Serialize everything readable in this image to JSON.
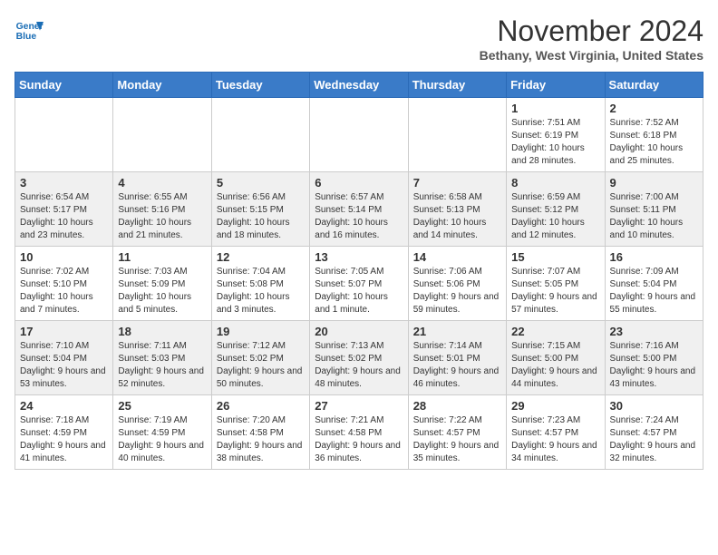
{
  "header": {
    "logo_line1": "General",
    "logo_line2": "Blue",
    "month": "November 2024",
    "location": "Bethany, West Virginia, United States"
  },
  "weekdays": [
    "Sunday",
    "Monday",
    "Tuesday",
    "Wednesday",
    "Thursday",
    "Friday",
    "Saturday"
  ],
  "weeks": [
    [
      {
        "day": "",
        "info": ""
      },
      {
        "day": "",
        "info": ""
      },
      {
        "day": "",
        "info": ""
      },
      {
        "day": "",
        "info": ""
      },
      {
        "day": "",
        "info": ""
      },
      {
        "day": "1",
        "info": "Sunrise: 7:51 AM\nSunset: 6:19 PM\nDaylight: 10 hours and 28 minutes."
      },
      {
        "day": "2",
        "info": "Sunrise: 7:52 AM\nSunset: 6:18 PM\nDaylight: 10 hours and 25 minutes."
      }
    ],
    [
      {
        "day": "3",
        "info": "Sunrise: 6:54 AM\nSunset: 5:17 PM\nDaylight: 10 hours and 23 minutes."
      },
      {
        "day": "4",
        "info": "Sunrise: 6:55 AM\nSunset: 5:16 PM\nDaylight: 10 hours and 21 minutes."
      },
      {
        "day": "5",
        "info": "Sunrise: 6:56 AM\nSunset: 5:15 PM\nDaylight: 10 hours and 18 minutes."
      },
      {
        "day": "6",
        "info": "Sunrise: 6:57 AM\nSunset: 5:14 PM\nDaylight: 10 hours and 16 minutes."
      },
      {
        "day": "7",
        "info": "Sunrise: 6:58 AM\nSunset: 5:13 PM\nDaylight: 10 hours and 14 minutes."
      },
      {
        "day": "8",
        "info": "Sunrise: 6:59 AM\nSunset: 5:12 PM\nDaylight: 10 hours and 12 minutes."
      },
      {
        "day": "9",
        "info": "Sunrise: 7:00 AM\nSunset: 5:11 PM\nDaylight: 10 hours and 10 minutes."
      }
    ],
    [
      {
        "day": "10",
        "info": "Sunrise: 7:02 AM\nSunset: 5:10 PM\nDaylight: 10 hours and 7 minutes."
      },
      {
        "day": "11",
        "info": "Sunrise: 7:03 AM\nSunset: 5:09 PM\nDaylight: 10 hours and 5 minutes."
      },
      {
        "day": "12",
        "info": "Sunrise: 7:04 AM\nSunset: 5:08 PM\nDaylight: 10 hours and 3 minutes."
      },
      {
        "day": "13",
        "info": "Sunrise: 7:05 AM\nSunset: 5:07 PM\nDaylight: 10 hours and 1 minute."
      },
      {
        "day": "14",
        "info": "Sunrise: 7:06 AM\nSunset: 5:06 PM\nDaylight: 9 hours and 59 minutes."
      },
      {
        "day": "15",
        "info": "Sunrise: 7:07 AM\nSunset: 5:05 PM\nDaylight: 9 hours and 57 minutes."
      },
      {
        "day": "16",
        "info": "Sunrise: 7:09 AM\nSunset: 5:04 PM\nDaylight: 9 hours and 55 minutes."
      }
    ],
    [
      {
        "day": "17",
        "info": "Sunrise: 7:10 AM\nSunset: 5:04 PM\nDaylight: 9 hours and 53 minutes."
      },
      {
        "day": "18",
        "info": "Sunrise: 7:11 AM\nSunset: 5:03 PM\nDaylight: 9 hours and 52 minutes."
      },
      {
        "day": "19",
        "info": "Sunrise: 7:12 AM\nSunset: 5:02 PM\nDaylight: 9 hours and 50 minutes."
      },
      {
        "day": "20",
        "info": "Sunrise: 7:13 AM\nSunset: 5:02 PM\nDaylight: 9 hours and 48 minutes."
      },
      {
        "day": "21",
        "info": "Sunrise: 7:14 AM\nSunset: 5:01 PM\nDaylight: 9 hours and 46 minutes."
      },
      {
        "day": "22",
        "info": "Sunrise: 7:15 AM\nSunset: 5:00 PM\nDaylight: 9 hours and 44 minutes."
      },
      {
        "day": "23",
        "info": "Sunrise: 7:16 AM\nSunset: 5:00 PM\nDaylight: 9 hours and 43 minutes."
      }
    ],
    [
      {
        "day": "24",
        "info": "Sunrise: 7:18 AM\nSunset: 4:59 PM\nDaylight: 9 hours and 41 minutes."
      },
      {
        "day": "25",
        "info": "Sunrise: 7:19 AM\nSunset: 4:59 PM\nDaylight: 9 hours and 40 minutes."
      },
      {
        "day": "26",
        "info": "Sunrise: 7:20 AM\nSunset: 4:58 PM\nDaylight: 9 hours and 38 minutes."
      },
      {
        "day": "27",
        "info": "Sunrise: 7:21 AM\nSunset: 4:58 PM\nDaylight: 9 hours and 36 minutes."
      },
      {
        "day": "28",
        "info": "Sunrise: 7:22 AM\nSunset: 4:57 PM\nDaylight: 9 hours and 35 minutes."
      },
      {
        "day": "29",
        "info": "Sunrise: 7:23 AM\nSunset: 4:57 PM\nDaylight: 9 hours and 34 minutes."
      },
      {
        "day": "30",
        "info": "Sunrise: 7:24 AM\nSunset: 4:57 PM\nDaylight: 9 hours and 32 minutes."
      }
    ]
  ]
}
